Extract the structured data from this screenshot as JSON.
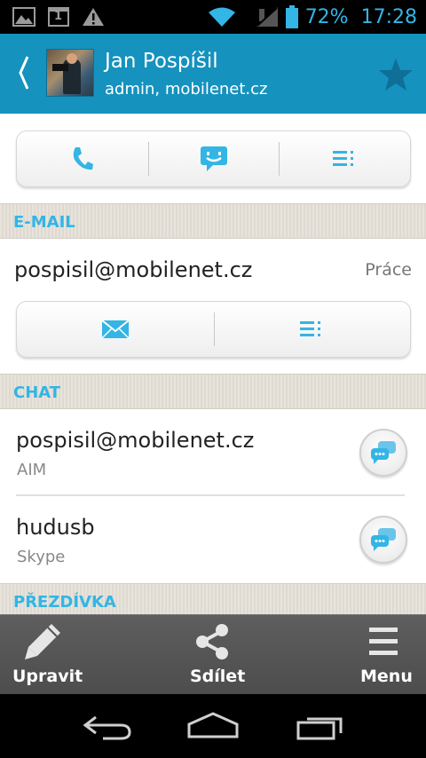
{
  "status": {
    "battery": "72%",
    "time": "17:28",
    "calendar_day": "1"
  },
  "header": {
    "name": "Jan Pospíšil",
    "subtitle": "admin, mobilenet.cz"
  },
  "sections": {
    "email": "E-MAIL",
    "chat": "CHAT",
    "nickname": "PŘEZDÍVKA"
  },
  "email": {
    "address": "pospisil@mobilenet.cz",
    "type": "Práce"
  },
  "chat": [
    {
      "handle": "pospisil@mobilenet.cz",
      "service": "AIM"
    },
    {
      "handle": "hudusb",
      "service": "Skype"
    }
  ],
  "toolbar": {
    "edit_label": "Upravit",
    "share_label": "Sdílet",
    "menu_label": "Menu"
  },
  "colors": {
    "accent": "#33b5e5",
    "actionbar": "#1592be",
    "toolbar": "#555555"
  }
}
